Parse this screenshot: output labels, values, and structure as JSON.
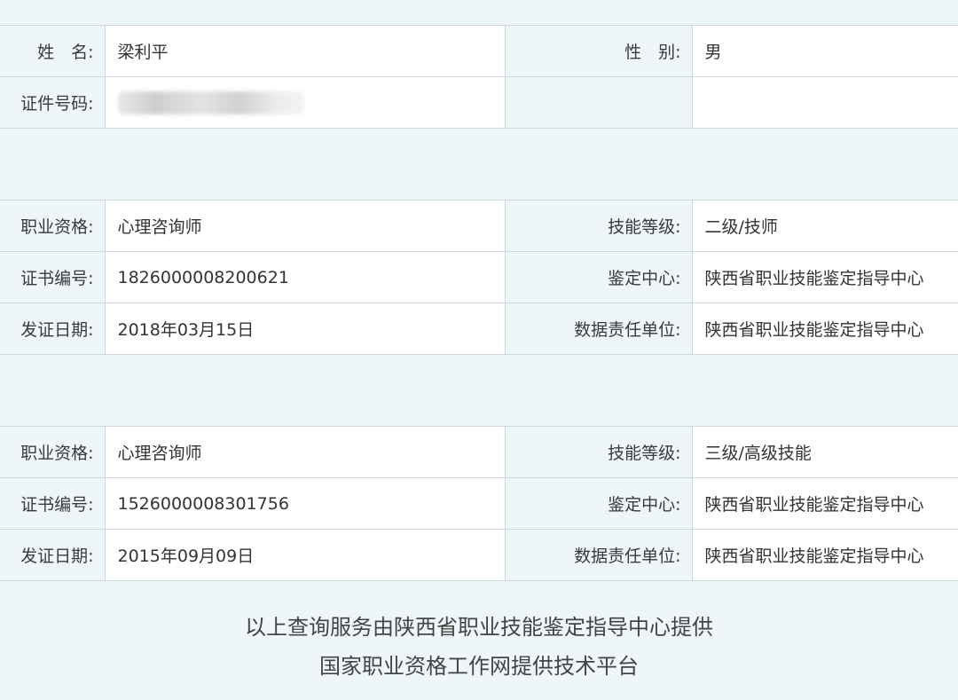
{
  "person": {
    "name_label": "姓　名:",
    "name": "梁利平",
    "gender_label": "性　别:",
    "gender": "男",
    "id_label": "证件号码:"
  },
  "certificates": [
    {
      "qualification_label": "职业资格:",
      "qualification": "心理咨询师",
      "level_label": "技能等级:",
      "level": "二级/技师",
      "cert_no_label": "证书编号:",
      "cert_no": "1826000008200621",
      "center_label": "鉴定中心:",
      "center": "陕西省职业技能鉴定指导中心",
      "date_label": "发证日期:",
      "date": "2018年03月15日",
      "responsible_label": "数据责任单位:",
      "responsible": "陕西省职业技能鉴定指导中心"
    },
    {
      "qualification_label": "职业资格:",
      "qualification": "心理咨询师",
      "level_label": "技能等级:",
      "level": "三级/高级技能",
      "cert_no_label": "证书编号:",
      "cert_no": "1526000008301756",
      "center_label": "鉴定中心:",
      "center": "陕西省职业技能鉴定指导中心",
      "date_label": "发证日期:",
      "date": "2015年09月09日",
      "responsible_label": "数据责任单位:",
      "responsible": "陕西省职业技能鉴定指导中心"
    }
  ],
  "footer": {
    "line1": "以上查询服务由陕西省职业技能鉴定指导中心提供",
    "line2": "国家职业资格工作网提供技术平台"
  }
}
